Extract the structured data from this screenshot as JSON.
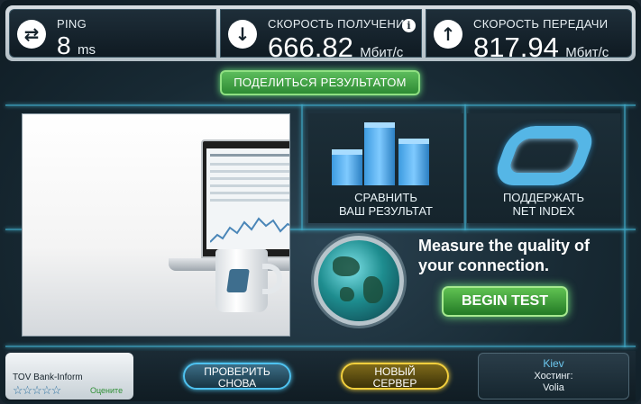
{
  "ping": {
    "label": "PING",
    "value": "8",
    "unit": "ms",
    "icon": "exchange-arrows-icon"
  },
  "download": {
    "label": "СКОРОСТЬ ПОЛУЧЕНИЯ",
    "value": "666.82",
    "unit": "Мбит/с",
    "icon": "download-arrow-icon",
    "info": "i"
  },
  "upload": {
    "label": "СКОРОСТЬ ПЕРЕДАЧИ",
    "value": "817.94",
    "unit": "Мбит/с",
    "icon": "upload-arrow-icon"
  },
  "share_button": "ПОДЕЛИТЬСЯ РЕЗУЛЬТАТОМ",
  "tiles": {
    "compare": {
      "line1": "СРАВНИТЬ",
      "line2": "ВАШ РЕЗУЛЬТАТ"
    },
    "support": {
      "line1": "ПОДДЕРЖАТЬ",
      "line2": "NET INDEX"
    }
  },
  "promo": {
    "line1": "Measure the quality of",
    "line2": "your connection.",
    "button": "BEGIN TEST"
  },
  "bottom": {
    "isp": "TOV Bank-Inform",
    "stars": "☆☆☆☆☆",
    "rate_label": "Оцените",
    "retest": {
      "line1": "ПРОВЕРИТЬ",
      "line2": "СНОВА"
    },
    "new_server": {
      "line1": "НОВЫЙ",
      "line2": "СЕРВЕР"
    },
    "host_city": "Kiev",
    "host_label": "Хостинг:",
    "host_name": "Volia"
  },
  "colors": {
    "accent_green": "#4fb44f",
    "accent_blue": "#4fc8f2",
    "accent_yellow": "#f2cf3d"
  }
}
